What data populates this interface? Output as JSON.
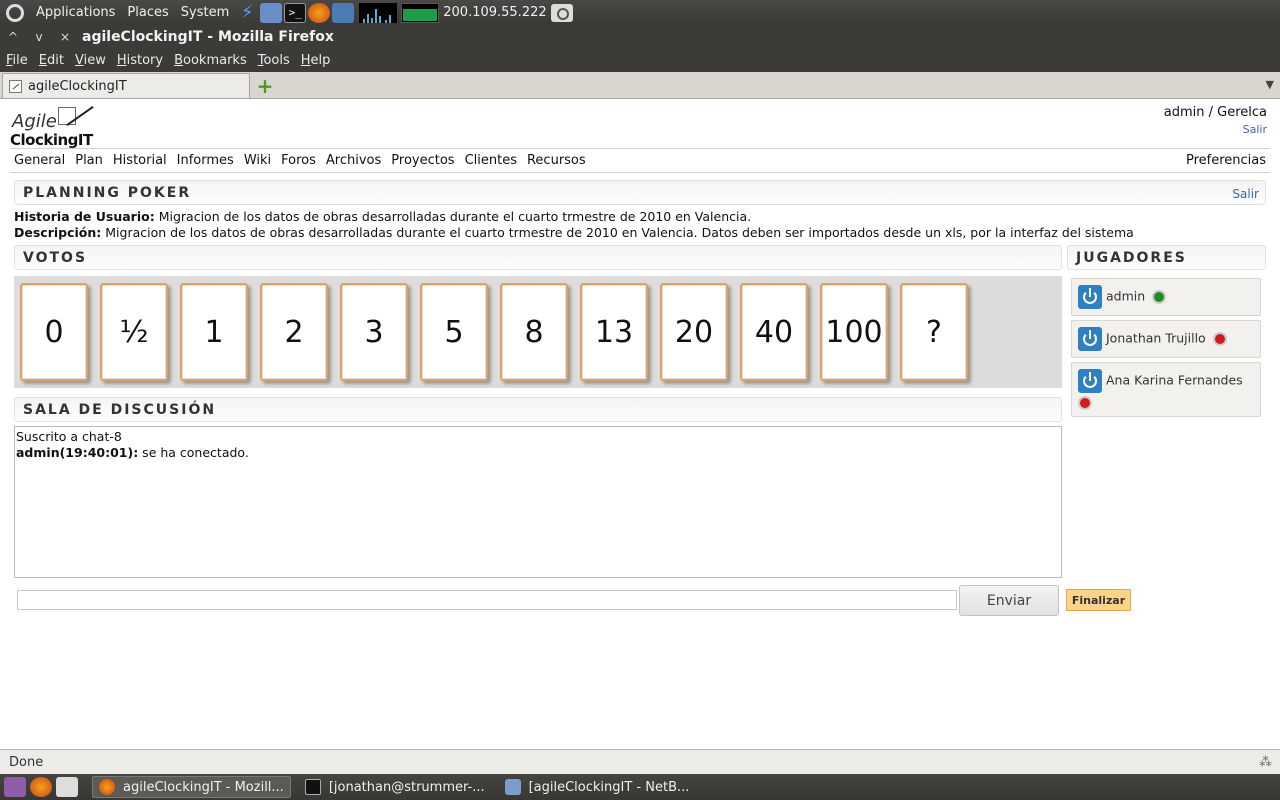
{
  "top_panel": {
    "menus": [
      "Applications",
      "Places",
      "System"
    ],
    "launchers": [
      "lightning-icon",
      "package-icon",
      "terminal-icon",
      "firefox-icon",
      "database-icon"
    ],
    "ip": "200.109.55.222"
  },
  "window": {
    "title": "agileClockingIT - Mozilla Firefox",
    "controls": [
      "^",
      "v",
      "×"
    ]
  },
  "menubar": [
    "File",
    "Edit",
    "View",
    "History",
    "Bookmarks",
    "Tools",
    "Help"
  ],
  "tabs": [
    {
      "label": "agileClockingIT"
    }
  ],
  "page": {
    "logo": {
      "line1": "Agile",
      "line2": "ClockingIT"
    },
    "user": {
      "name": "admin / Gerelca",
      "logout": "Salir"
    },
    "nav": [
      "General",
      "Plan",
      "Historial",
      "Informes",
      "Wiki",
      "Foros",
      "Archivos",
      "Proyectos",
      "Clientes",
      "Recursos"
    ],
    "nav_right": "Preferencias",
    "poker": {
      "title": "PLANNING POKER",
      "exit": "Salir",
      "story_label": "Historia de Usuario:",
      "story_text": "Migracion de los datos de obras desarrolladas durante el cuarto trmestre de 2010 en Valencia.",
      "desc_label": "Descripción:",
      "desc_text": "Migracion de los datos de obras desarrolladas durante el cuarto trmestre de 2010 en Valencia. Datos deben ser importados desde un xls, por la interfaz del sistema"
    },
    "votes": {
      "title": "VOTOS",
      "cards": [
        "0",
        "½",
        "1",
        "2",
        "3",
        "5",
        "8",
        "13",
        "20",
        "40",
        "100",
        "?"
      ]
    },
    "players": {
      "title": "JUGADORES",
      "list": [
        {
          "name": "admin",
          "status": "online"
        },
        {
          "name": "Jonathan Trujillo",
          "status": "offline"
        },
        {
          "name": "Ana Karina Fernandes",
          "status": "offline"
        }
      ]
    },
    "chat": {
      "title": "SALA DE DISCUSIÓN",
      "subscribed": "Suscrito a chat-8",
      "messages": [
        {
          "author": "admin(19:40:01):",
          "text": " se ha conectado."
        }
      ],
      "input_value": "",
      "send_label": "Enviar",
      "finish_label": "Finalizar"
    }
  },
  "statusbar": {
    "text": "Done"
  },
  "taskbar": {
    "tasks": [
      {
        "label": "agileClockingIT - Mozill...",
        "active": true,
        "icon": "firefox-icon"
      },
      {
        "label": "[jonathan@strummer-...",
        "active": false,
        "icon": "terminal-icon"
      },
      {
        "label": "[agileClockingIT - NetB...",
        "active": false,
        "icon": "netbeans-icon"
      }
    ]
  },
  "colors": {
    "panel_bg": "#3c3b37",
    "link": "#3b64b5",
    "card_border": "#e6a05c",
    "finish_bg": "#fdd38a",
    "online": "#1f8c1f",
    "offline": "#d11a1a",
    "player_icon": "#2f7fc3"
  }
}
